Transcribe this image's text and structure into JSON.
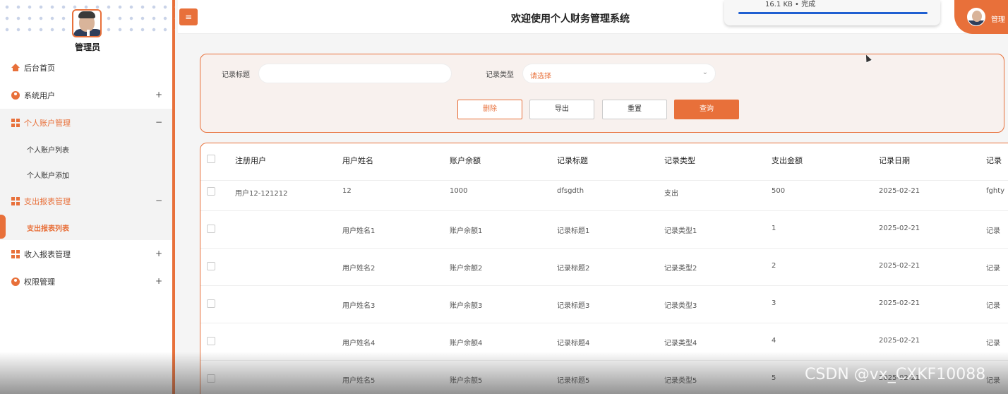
{
  "sidebar": {
    "admin_name": "管理员",
    "items": [
      {
        "label": "后台首页",
        "icon": "home-icon",
        "sign": ""
      },
      {
        "label": "系统用户",
        "icon": "user-icon",
        "sign": "+"
      },
      {
        "label": "个人账户管理",
        "icon": "grid-icon",
        "sign": "−"
      },
      {
        "label": "个人账户列表"
      },
      {
        "label": "个人账户添加"
      },
      {
        "label": "支出报表管理",
        "icon": "grid-icon",
        "sign": "−"
      },
      {
        "label": "支出报表列表"
      },
      {
        "label": "收入报表管理",
        "icon": "grid-icon",
        "sign": "+"
      },
      {
        "label": "权限管理",
        "icon": "user-icon",
        "sign": "+"
      }
    ]
  },
  "header": {
    "menu_icon": "hamburger-icon",
    "title": "欢迎使用个人财务管理系统",
    "download_status": "16.1 KB • 完成",
    "user_label": "管理"
  },
  "search": {
    "title_label": "记录标题",
    "title_value": "",
    "type_label": "记录类型",
    "type_value": "请选择",
    "buttons": {
      "delete": "删除",
      "export": "导出",
      "reset": "重置",
      "query": "查询"
    }
  },
  "table": {
    "columns": [
      "注册用户",
      "用户姓名",
      "账户余额",
      "记录标题",
      "记录类型",
      "支出金额",
      "记录日期",
      "记录"
    ],
    "rows": [
      [
        "用户12-121212",
        "12",
        "1000",
        "dfsgdth",
        "支出",
        "500",
        "2025-02-21",
        "fghty"
      ],
      [
        "",
        "用户姓名1",
        "账户余额1",
        "记录标题1",
        "记录类型1",
        "1",
        "2025-02-21",
        "记录"
      ],
      [
        "",
        "用户姓名2",
        "账户余额2",
        "记录标题2",
        "记录类型2",
        "2",
        "2025-02-21",
        "记录"
      ],
      [
        "",
        "用户姓名3",
        "账户余额3",
        "记录标题3",
        "记录类型3",
        "3",
        "2025-02-21",
        "记录"
      ],
      [
        "",
        "用户姓名4",
        "账户余额4",
        "记录标题4",
        "记录类型4",
        "4",
        "2025-02-21",
        "记录"
      ],
      [
        "",
        "用户姓名5",
        "账户余额5",
        "记录标题5",
        "记录类型5",
        "5",
        "2025-02-21",
        "记录"
      ]
    ]
  },
  "watermark": "CSDN @vx_CXKF10088",
  "colors": {
    "accent": "#e8703a",
    "download_bar": "#1f5fd1"
  }
}
